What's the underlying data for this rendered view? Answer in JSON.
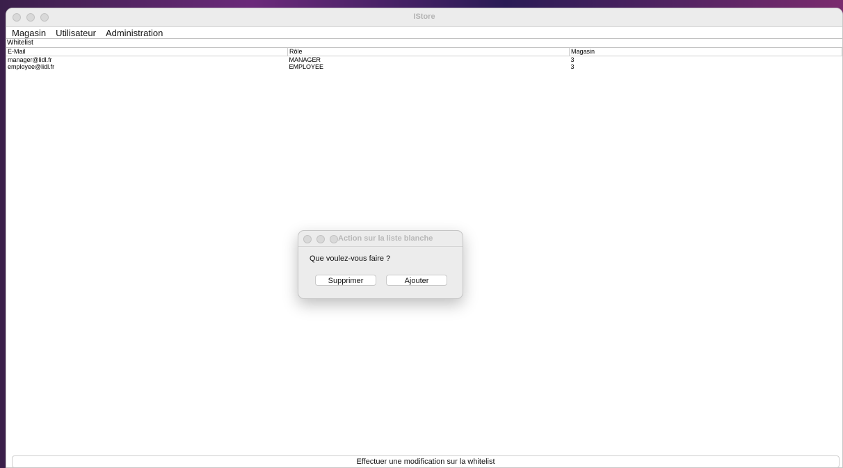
{
  "window": {
    "title": "IStore"
  },
  "menu": {
    "items": [
      "Magasin",
      "Utilisateur",
      "Administration"
    ]
  },
  "panel": {
    "label": "Whitelist"
  },
  "table": {
    "columns": [
      "E-Mail",
      "Rôle",
      "Magasin"
    ],
    "rows": [
      [
        "manager@lidl.fr",
        "MANAGER",
        "3"
      ],
      [
        "employee@lidl.fr",
        "EMPLOYEE",
        "3"
      ]
    ]
  },
  "dialog": {
    "title": "Action sur la liste blanche",
    "message": "Que voulez-vous faire ?",
    "buttons": {
      "delete": "Supprimer",
      "add": "Ajouter"
    }
  },
  "status": {
    "button": "Effectuer une modification sur la whitelist"
  }
}
